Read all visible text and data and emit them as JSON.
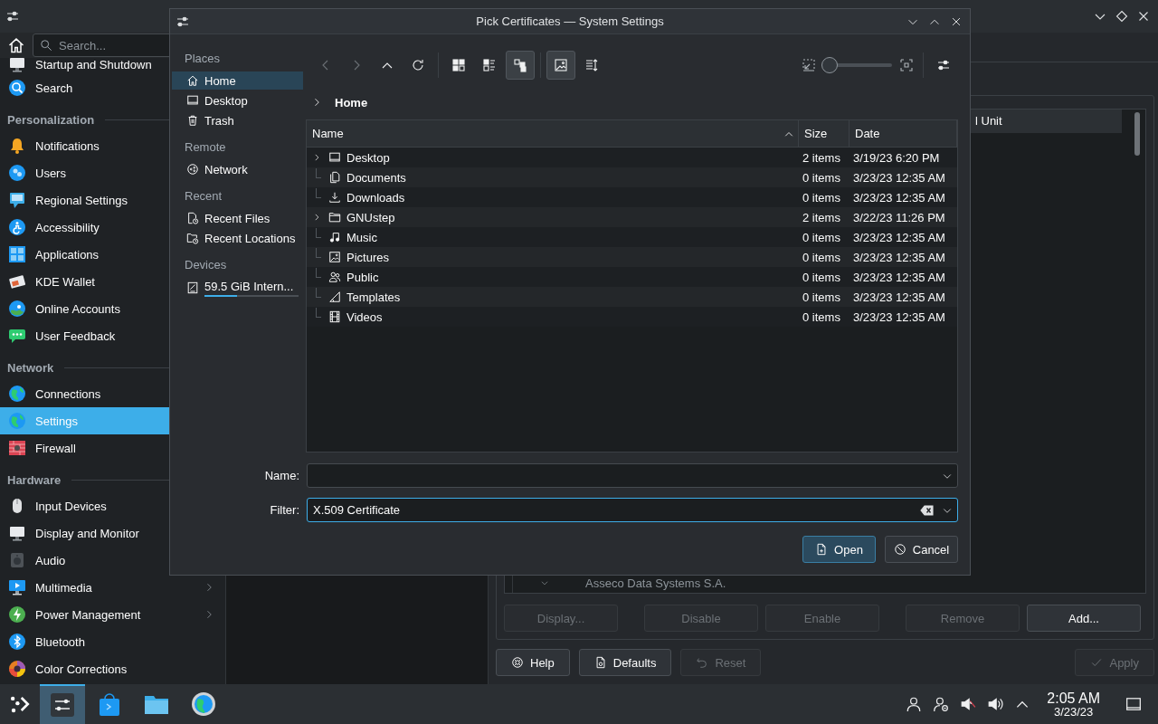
{
  "settings_window": {
    "sidebar": {
      "search": {
        "placeholder": "Search..."
      },
      "items": [
        {
          "kind": "item",
          "label": "Startup and Shutdown",
          "selected": false
        },
        {
          "kind": "item",
          "label": "Search",
          "selected": false
        },
        {
          "kind": "section",
          "label": "Personalization"
        },
        {
          "kind": "item",
          "label": "Notifications",
          "selected": false
        },
        {
          "kind": "item",
          "label": "Users",
          "selected": false
        },
        {
          "kind": "item",
          "label": "Regional Settings",
          "selected": false
        },
        {
          "kind": "item",
          "label": "Accessibility",
          "selected": false
        },
        {
          "kind": "item",
          "label": "Applications",
          "selected": false
        },
        {
          "kind": "item",
          "label": "KDE Wallet",
          "selected": false
        },
        {
          "kind": "item",
          "label": "Online Accounts",
          "selected": false
        },
        {
          "kind": "item",
          "label": "User Feedback",
          "selected": false
        },
        {
          "kind": "section",
          "label": "Network"
        },
        {
          "kind": "item",
          "label": "Connections",
          "selected": false
        },
        {
          "kind": "item",
          "label": "Settings",
          "selected": true
        },
        {
          "kind": "item",
          "label": "Firewall",
          "selected": false
        },
        {
          "kind": "section",
          "label": "Hardware"
        },
        {
          "kind": "item",
          "label": "Input Devices",
          "selected": false
        },
        {
          "kind": "item",
          "label": "Display and Monitor",
          "selected": false
        },
        {
          "kind": "item",
          "label": "Audio",
          "selected": false
        },
        {
          "kind": "item",
          "label": "Multimedia",
          "selected": false,
          "has_submenu": true
        },
        {
          "kind": "item",
          "label": "Power Management",
          "selected": false,
          "has_submenu": true
        },
        {
          "kind": "item",
          "label": "Bluetooth",
          "selected": false,
          "has_submenu": false
        },
        {
          "kind": "item",
          "label": "Color Corrections",
          "selected": false,
          "has_submenu": false
        }
      ]
    },
    "certificate_list": {
      "column_header": "l Unit",
      "rows": [
        {
          "label": "Asseco Data Systems S.A.",
          "expanded": true
        }
      ]
    },
    "list_buttons": [
      {
        "label": "Display...",
        "disabled": true
      },
      {
        "label": "Disable",
        "disabled": true
      },
      {
        "label": "Enable",
        "disabled": true
      },
      {
        "label": "Remove",
        "disabled": true
      },
      {
        "label": "Add...",
        "disabled": false
      }
    ],
    "footer_buttons": [
      {
        "kind": "help",
        "label": "Help",
        "disabled": false
      },
      {
        "kind": "defaults",
        "label": "Defaults",
        "disabled": false
      },
      {
        "kind": "reset",
        "label": "Reset",
        "disabled": true
      },
      {
        "kind": "apply",
        "label": "Apply",
        "disabled": true
      }
    ]
  },
  "dialog": {
    "title": "Pick Certificates — System Settings",
    "places": [
      {
        "kind": "heading",
        "label": "Places"
      },
      {
        "kind": "place",
        "label": "Home",
        "selected": true
      },
      {
        "kind": "place",
        "label": "Desktop",
        "selected": false
      },
      {
        "kind": "place",
        "label": "Trash",
        "selected": false
      },
      {
        "kind": "heading",
        "label": "Remote"
      },
      {
        "kind": "place",
        "label": "Network",
        "selected": false
      },
      {
        "kind": "heading",
        "label": "Recent"
      },
      {
        "kind": "place",
        "label": "Recent Files",
        "selected": false
      },
      {
        "kind": "place",
        "label": "Recent Locations",
        "selected": false
      },
      {
        "kind": "heading",
        "label": "Devices"
      },
      {
        "kind": "device",
        "label": "59.5 GiB Intern...",
        "selected": false,
        "level": 0.35
      }
    ],
    "toolbar": [
      {
        "disabled": true,
        "selected": false
      },
      {
        "disabled": true,
        "selected": false
      },
      {
        "disabled": false,
        "selected": false
      },
      {
        "disabled": false,
        "selected": false
      },
      {
        "disabled": false,
        "selected": false
      },
      {
        "disabled": false,
        "selected": false
      },
      {
        "disabled": false,
        "selected": true
      },
      {
        "disabled": false,
        "selected": true
      },
      {
        "disabled": false,
        "selected": false
      }
    ],
    "zoom": {
      "level": 0
    },
    "breadcrumb": "Home",
    "columns": [
      {
        "label": "Name",
        "sorted": true
      },
      {
        "label": "Size",
        "sorted": false
      },
      {
        "label": "Date",
        "sorted": false
      }
    ],
    "files": [
      {
        "name": "Desktop",
        "size": "2 items",
        "date": "3/19/23 6:20 PM",
        "expandable": true
      },
      {
        "name": "Documents",
        "size": "0 items",
        "date": "3/23/23 12:35 AM",
        "expandable": false
      },
      {
        "name": "Downloads",
        "size": "0 items",
        "date": "3/23/23 12:35 AM",
        "expandable": false
      },
      {
        "name": "GNUstep",
        "size": "2 items",
        "date": "3/22/23 11:26 PM",
        "expandable": true
      },
      {
        "name": "Music",
        "size": "0 items",
        "date": "3/23/23 12:35 AM",
        "expandable": false
      },
      {
        "name": "Pictures",
        "size": "0 items",
        "date": "3/23/23 12:35 AM",
        "expandable": false
      },
      {
        "name": "Public",
        "size": "0 items",
        "date": "3/23/23 12:35 AM",
        "expandable": false
      },
      {
        "name": "Templates",
        "size": "0 items",
        "date": "3/23/23 12:35 AM",
        "expandable": false
      },
      {
        "name": "Videos",
        "size": "0 items",
        "date": "3/23/23 12:35 AM",
        "expandable": false
      }
    ],
    "fields": [
      {
        "label": "Name:",
        "focused": false
      },
      {
        "label": "Filter:",
        "value": "X.509 Certificate",
        "focused": true
      }
    ],
    "buttons": [
      {
        "kind": "open",
        "label": "Open",
        "default": true
      },
      {
        "kind": "cancel",
        "label": "Cancel",
        "default": false
      }
    ]
  },
  "taskbar": {
    "tasks": [
      {
        "active": true
      },
      {
        "active": false
      },
      {
        "active": false
      },
      {
        "active": false
      }
    ],
    "clock": {
      "time": "2:05 AM",
      "date": "3/23/23"
    }
  }
}
